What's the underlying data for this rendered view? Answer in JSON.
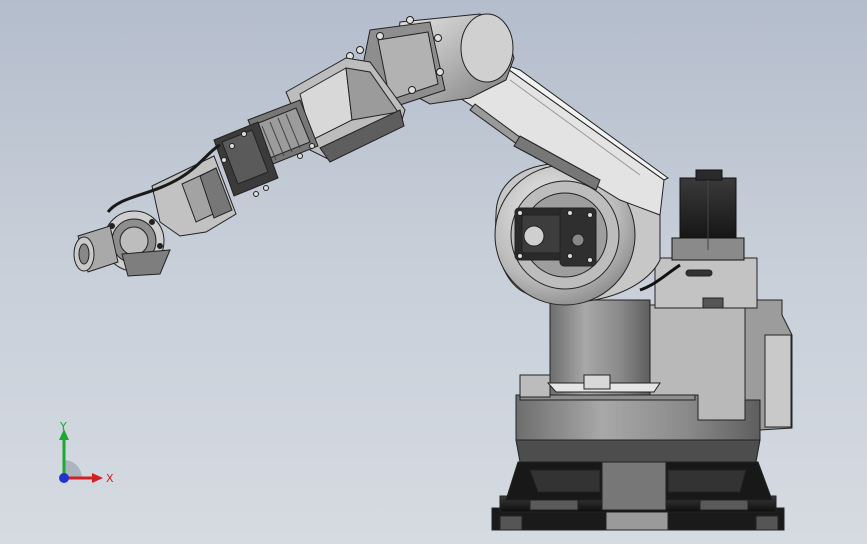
{
  "viewport": {
    "background_top": "#b4bdcc",
    "background_bottom": "#d6dbe2"
  },
  "model": {
    "type": "6-axis industrial robot arm",
    "body_color": "#a9a9a9",
    "dark_color": "#1b1b1b",
    "edge_color": "#2a2a2a"
  },
  "triad": {
    "x_label": "X",
    "y_label": "Y",
    "x_color": "#d42020",
    "y_color": "#1ea832",
    "z_color": "#2233cc"
  }
}
